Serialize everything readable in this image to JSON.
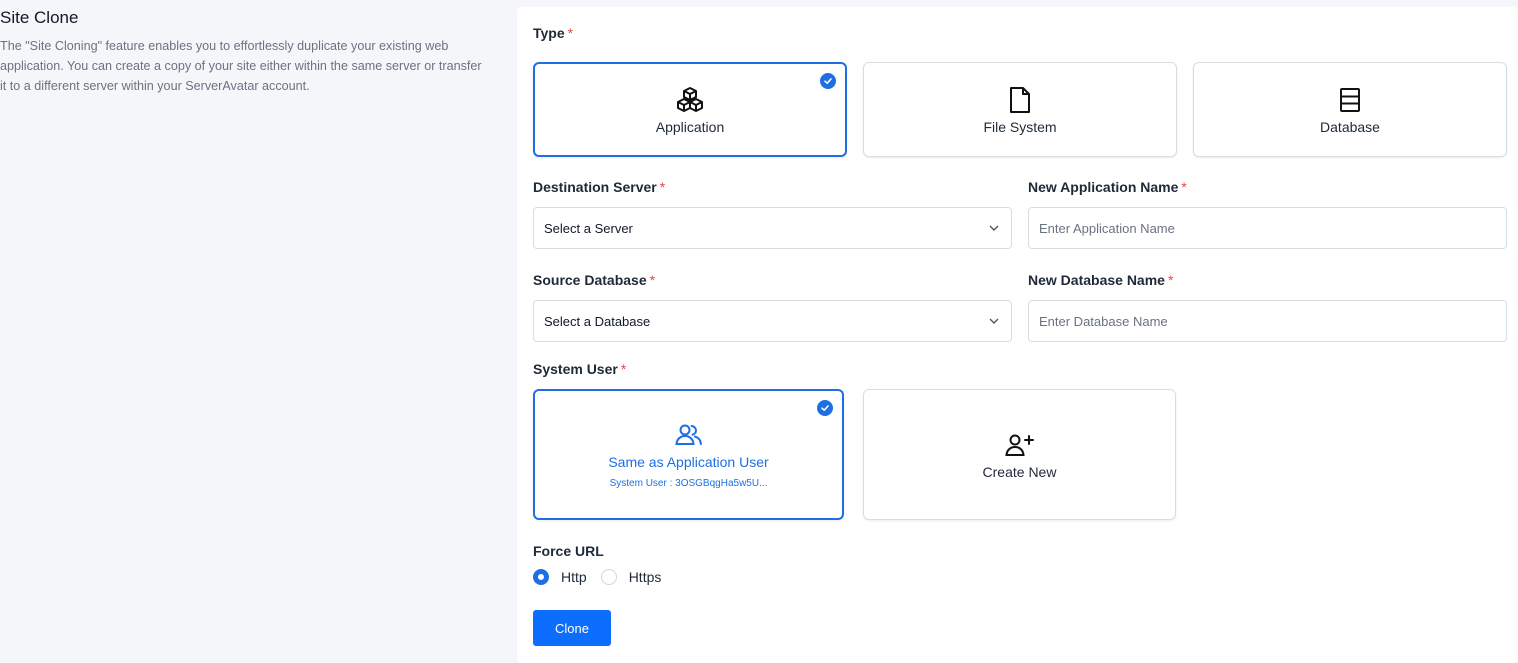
{
  "intro": {
    "title": "Site Clone",
    "description": "The \"Site Cloning\" feature enables you to effortlessly duplicate your existing web application. You can create a copy of your site either within the same server or transfer it to a different server within your ServerAvatar account."
  },
  "type_section": {
    "label": "Type",
    "required_mark": "*",
    "options": [
      {
        "label": "Application",
        "icon": "cubes-icon",
        "selected": true
      },
      {
        "label": "File System",
        "icon": "file-icon",
        "selected": false
      },
      {
        "label": "Database",
        "icon": "database-icon",
        "selected": false
      }
    ]
  },
  "destination_server": {
    "label": "Destination Server",
    "required_mark": "*",
    "value": "Select a Server"
  },
  "new_application_name": {
    "label": "New Application Name",
    "required_mark": "*",
    "placeholder": "Enter Application Name"
  },
  "source_database": {
    "label": "Source Database",
    "required_mark": "*",
    "value": "Select a Database"
  },
  "new_database_name": {
    "label": "New Database Name",
    "required_mark": "*",
    "placeholder": "Enter Database Name"
  },
  "system_user": {
    "label": "System User",
    "required_mark": "*",
    "options": [
      {
        "label": "Same as Application User",
        "sub": "System User :  3OSGBqgHa5w5U...",
        "icon": "users-icon",
        "selected": true
      },
      {
        "label": "Create New",
        "icon": "user-plus-icon",
        "selected": false
      }
    ]
  },
  "force_url": {
    "label": "Force URL",
    "options": [
      {
        "label": "Http",
        "selected": true
      },
      {
        "label": "Https",
        "selected": false
      }
    ]
  },
  "submit": {
    "label": "Clone"
  },
  "colors": {
    "accent": "#1d6fe3",
    "button": "#0d6efd",
    "required": "#ef4444"
  }
}
